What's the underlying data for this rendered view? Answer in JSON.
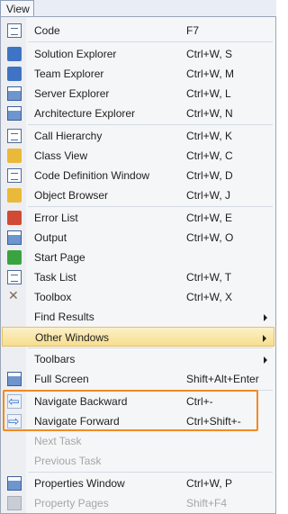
{
  "menu_title": "View",
  "items": [
    {
      "label": "Code",
      "shortcut": "F7",
      "icon": "code-icon"
    },
    {
      "label": "Solution Explorer",
      "shortcut": "Ctrl+W, S",
      "icon": "solution-explorer-icon"
    },
    {
      "label": "Team Explorer",
      "shortcut": "Ctrl+W, M",
      "icon": "team-explorer-icon"
    },
    {
      "label": "Server Explorer",
      "shortcut": "Ctrl+W, L",
      "icon": "server-explorer-icon"
    },
    {
      "label": "Architecture Explorer",
      "shortcut": "Ctrl+W, N",
      "icon": "architecture-explorer-icon"
    },
    {
      "label": "Call Hierarchy",
      "shortcut": "Ctrl+W, K",
      "icon": "call-hierarchy-icon"
    },
    {
      "label": "Class View",
      "shortcut": "Ctrl+W, C",
      "icon": "class-view-icon"
    },
    {
      "label": "Code Definition Window",
      "shortcut": "Ctrl+W, D",
      "icon": "code-definition-icon"
    },
    {
      "label": "Object Browser",
      "shortcut": "Ctrl+W, J",
      "icon": "object-browser-icon"
    },
    {
      "label": "Error List",
      "shortcut": "Ctrl+W, E",
      "icon": "error-list-icon"
    },
    {
      "label": "Output",
      "shortcut": "Ctrl+W, O",
      "icon": "output-icon"
    },
    {
      "label": "Start Page",
      "shortcut": "",
      "icon": "start-page-icon"
    },
    {
      "label": "Task List",
      "shortcut": "Ctrl+W, T",
      "icon": "task-list-icon"
    },
    {
      "label": "Toolbox",
      "shortcut": "Ctrl+W, X",
      "icon": "toolbox-icon"
    },
    {
      "label": "Find Results",
      "shortcut": "",
      "submenu": true
    },
    {
      "label": "Other Windows",
      "shortcut": "",
      "submenu": true,
      "highlighted": true
    },
    {
      "label": "Toolbars",
      "shortcut": "",
      "submenu": true
    },
    {
      "label": "Full Screen",
      "shortcut": "Shift+Alt+Enter",
      "icon": "full-screen-icon"
    },
    {
      "label": "Navigate Backward",
      "shortcut": "Ctrl+-",
      "icon": "navigate-backward-icon"
    },
    {
      "label": "Navigate Forward",
      "shortcut": "Ctrl+Shift+-",
      "icon": "navigate-forward-icon"
    },
    {
      "label": "Next Task",
      "shortcut": "",
      "disabled": true
    },
    {
      "label": "Previous Task",
      "shortcut": "",
      "disabled": true
    },
    {
      "label": "Properties Window",
      "shortcut": "Ctrl+W, P",
      "icon": "properties-window-icon"
    },
    {
      "label": "Property Pages",
      "shortcut": "Shift+F4",
      "icon": "property-pages-icon",
      "disabled": true
    }
  ],
  "colors": {
    "highlight": "#f7de8e",
    "callout": "#f08a24",
    "disabled_text": "#a6a6a6"
  }
}
